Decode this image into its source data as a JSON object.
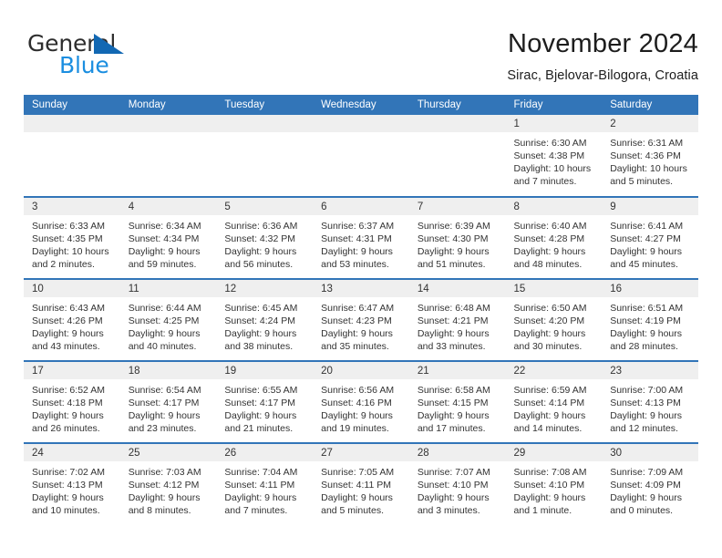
{
  "brand": {
    "name_top": "General",
    "name_bottom": "Blue",
    "accent_blue": "#1268b3",
    "light_blue": "#1b8ee0"
  },
  "header": {
    "title": "November 2024",
    "location": "Sirac, Bjelovar-Bilogora, Croatia"
  },
  "theme": {
    "header_bg": "#3275b8",
    "daynum_bg": "#efefef",
    "text": "#333333"
  },
  "calendar": {
    "weekday_headers": [
      "Sunday",
      "Monday",
      "Tuesday",
      "Wednesday",
      "Thursday",
      "Friday",
      "Saturday"
    ],
    "weeks": [
      [
        {
          "day": "",
          "sunrise": "",
          "sunset": "",
          "daylight": "",
          "daylight2": "",
          "blank": true
        },
        {
          "day": "",
          "sunrise": "",
          "sunset": "",
          "daylight": "",
          "daylight2": "",
          "blank": true
        },
        {
          "day": "",
          "sunrise": "",
          "sunset": "",
          "daylight": "",
          "daylight2": "",
          "blank": true
        },
        {
          "day": "",
          "sunrise": "",
          "sunset": "",
          "daylight": "",
          "daylight2": "",
          "blank": true
        },
        {
          "day": "",
          "sunrise": "",
          "sunset": "",
          "daylight": "",
          "daylight2": "",
          "blank": true
        },
        {
          "day": "1",
          "sunrise": "Sunrise: 6:30 AM",
          "sunset": "Sunset: 4:38 PM",
          "daylight": "Daylight: 10 hours",
          "daylight2": "and 7 minutes.",
          "blank": false
        },
        {
          "day": "2",
          "sunrise": "Sunrise: 6:31 AM",
          "sunset": "Sunset: 4:36 PM",
          "daylight": "Daylight: 10 hours",
          "daylight2": "and 5 minutes.",
          "blank": false
        }
      ],
      [
        {
          "day": "3",
          "sunrise": "Sunrise: 6:33 AM",
          "sunset": "Sunset: 4:35 PM",
          "daylight": "Daylight: 10 hours",
          "daylight2": "and 2 minutes.",
          "blank": false
        },
        {
          "day": "4",
          "sunrise": "Sunrise: 6:34 AM",
          "sunset": "Sunset: 4:34 PM",
          "daylight": "Daylight: 9 hours",
          "daylight2": "and 59 minutes.",
          "blank": false
        },
        {
          "day": "5",
          "sunrise": "Sunrise: 6:36 AM",
          "sunset": "Sunset: 4:32 PM",
          "daylight": "Daylight: 9 hours",
          "daylight2": "and 56 minutes.",
          "blank": false
        },
        {
          "day": "6",
          "sunrise": "Sunrise: 6:37 AM",
          "sunset": "Sunset: 4:31 PM",
          "daylight": "Daylight: 9 hours",
          "daylight2": "and 53 minutes.",
          "blank": false
        },
        {
          "day": "7",
          "sunrise": "Sunrise: 6:39 AM",
          "sunset": "Sunset: 4:30 PM",
          "daylight": "Daylight: 9 hours",
          "daylight2": "and 51 minutes.",
          "blank": false
        },
        {
          "day": "8",
          "sunrise": "Sunrise: 6:40 AM",
          "sunset": "Sunset: 4:28 PM",
          "daylight": "Daylight: 9 hours",
          "daylight2": "and 48 minutes.",
          "blank": false
        },
        {
          "day": "9",
          "sunrise": "Sunrise: 6:41 AM",
          "sunset": "Sunset: 4:27 PM",
          "daylight": "Daylight: 9 hours",
          "daylight2": "and 45 minutes.",
          "blank": false
        }
      ],
      [
        {
          "day": "10",
          "sunrise": "Sunrise: 6:43 AM",
          "sunset": "Sunset: 4:26 PM",
          "daylight": "Daylight: 9 hours",
          "daylight2": "and 43 minutes.",
          "blank": false
        },
        {
          "day": "11",
          "sunrise": "Sunrise: 6:44 AM",
          "sunset": "Sunset: 4:25 PM",
          "daylight": "Daylight: 9 hours",
          "daylight2": "and 40 minutes.",
          "blank": false
        },
        {
          "day": "12",
          "sunrise": "Sunrise: 6:45 AM",
          "sunset": "Sunset: 4:24 PM",
          "daylight": "Daylight: 9 hours",
          "daylight2": "and 38 minutes.",
          "blank": false
        },
        {
          "day": "13",
          "sunrise": "Sunrise: 6:47 AM",
          "sunset": "Sunset: 4:23 PM",
          "daylight": "Daylight: 9 hours",
          "daylight2": "and 35 minutes.",
          "blank": false
        },
        {
          "day": "14",
          "sunrise": "Sunrise: 6:48 AM",
          "sunset": "Sunset: 4:21 PM",
          "daylight": "Daylight: 9 hours",
          "daylight2": "and 33 minutes.",
          "blank": false
        },
        {
          "day": "15",
          "sunrise": "Sunrise: 6:50 AM",
          "sunset": "Sunset: 4:20 PM",
          "daylight": "Daylight: 9 hours",
          "daylight2": "and 30 minutes.",
          "blank": false
        },
        {
          "day": "16",
          "sunrise": "Sunrise: 6:51 AM",
          "sunset": "Sunset: 4:19 PM",
          "daylight": "Daylight: 9 hours",
          "daylight2": "and 28 minutes.",
          "blank": false
        }
      ],
      [
        {
          "day": "17",
          "sunrise": "Sunrise: 6:52 AM",
          "sunset": "Sunset: 4:18 PM",
          "daylight": "Daylight: 9 hours",
          "daylight2": "and 26 minutes.",
          "blank": false
        },
        {
          "day": "18",
          "sunrise": "Sunrise: 6:54 AM",
          "sunset": "Sunset: 4:17 PM",
          "daylight": "Daylight: 9 hours",
          "daylight2": "and 23 minutes.",
          "blank": false
        },
        {
          "day": "19",
          "sunrise": "Sunrise: 6:55 AM",
          "sunset": "Sunset: 4:17 PM",
          "daylight": "Daylight: 9 hours",
          "daylight2": "and 21 minutes.",
          "blank": false
        },
        {
          "day": "20",
          "sunrise": "Sunrise: 6:56 AM",
          "sunset": "Sunset: 4:16 PM",
          "daylight": "Daylight: 9 hours",
          "daylight2": "and 19 minutes.",
          "blank": false
        },
        {
          "day": "21",
          "sunrise": "Sunrise: 6:58 AM",
          "sunset": "Sunset: 4:15 PM",
          "daylight": "Daylight: 9 hours",
          "daylight2": "and 17 minutes.",
          "blank": false
        },
        {
          "day": "22",
          "sunrise": "Sunrise: 6:59 AM",
          "sunset": "Sunset: 4:14 PM",
          "daylight": "Daylight: 9 hours",
          "daylight2": "and 14 minutes.",
          "blank": false
        },
        {
          "day": "23",
          "sunrise": "Sunrise: 7:00 AM",
          "sunset": "Sunset: 4:13 PM",
          "daylight": "Daylight: 9 hours",
          "daylight2": "and 12 minutes.",
          "blank": false
        }
      ],
      [
        {
          "day": "24",
          "sunrise": "Sunrise: 7:02 AM",
          "sunset": "Sunset: 4:13 PM",
          "daylight": "Daylight: 9 hours",
          "daylight2": "and 10 minutes.",
          "blank": false
        },
        {
          "day": "25",
          "sunrise": "Sunrise: 7:03 AM",
          "sunset": "Sunset: 4:12 PM",
          "daylight": "Daylight: 9 hours",
          "daylight2": "and 8 minutes.",
          "blank": false
        },
        {
          "day": "26",
          "sunrise": "Sunrise: 7:04 AM",
          "sunset": "Sunset: 4:11 PM",
          "daylight": "Daylight: 9 hours",
          "daylight2": "and 7 minutes.",
          "blank": false
        },
        {
          "day": "27",
          "sunrise": "Sunrise: 7:05 AM",
          "sunset": "Sunset: 4:11 PM",
          "daylight": "Daylight: 9 hours",
          "daylight2": "and 5 minutes.",
          "blank": false
        },
        {
          "day": "28",
          "sunrise": "Sunrise: 7:07 AM",
          "sunset": "Sunset: 4:10 PM",
          "daylight": "Daylight: 9 hours",
          "daylight2": "and 3 minutes.",
          "blank": false
        },
        {
          "day": "29",
          "sunrise": "Sunrise: 7:08 AM",
          "sunset": "Sunset: 4:10 PM",
          "daylight": "Daylight: 9 hours",
          "daylight2": "and 1 minute.",
          "blank": false
        },
        {
          "day": "30",
          "sunrise": "Sunrise: 7:09 AM",
          "sunset": "Sunset: 4:09 PM",
          "daylight": "Daylight: 9 hours",
          "daylight2": "and 0 minutes.",
          "blank": false
        }
      ]
    ]
  }
}
